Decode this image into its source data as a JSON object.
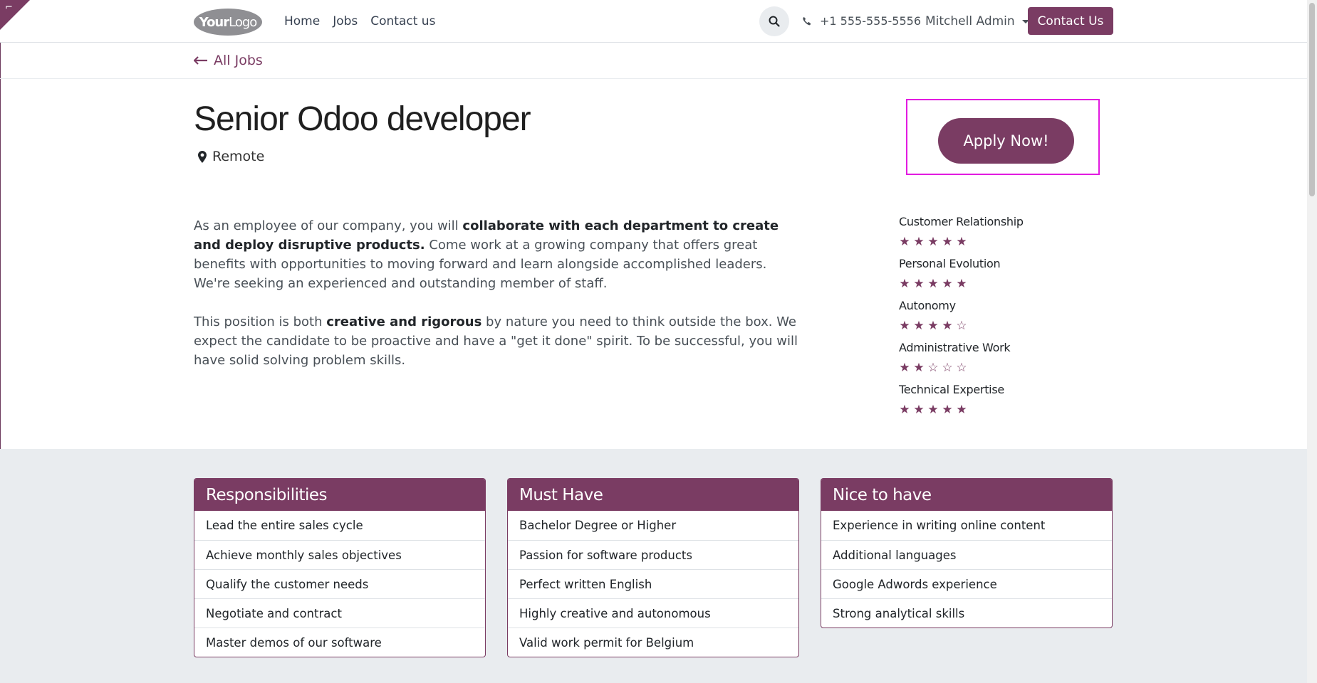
{
  "header": {
    "logo_main": "Your",
    "logo_thin": "Logo",
    "nav": [
      "Home",
      "Jobs",
      "Contact us"
    ],
    "phone": "+1 555-555-5556",
    "user": "Mitchell Admin",
    "contact_button": "Contact Us"
  },
  "back": {
    "label": "All Jobs"
  },
  "job": {
    "title": "Senior Odoo developer",
    "location": "Remote",
    "apply_label": "Apply Now!"
  },
  "description": {
    "p1_a": "As an employee of our company, you will ",
    "p1_b": "collaborate with each department to create and deploy disruptive products.",
    "p1_c": " Come work at a growing company that offers great benefits with opportunities to moving forward and learn alongside accomplished leaders. We're seeking an experienced and outstanding member of staff.",
    "p2_a": "This position is both ",
    "p2_b": "creative and rigorous",
    "p2_c": " by nature you need to think outside the box. We expect the candidate to be proactive and have a \"get it done\" spirit. To be successful, you will have solid solving problem skills."
  },
  "ratings": [
    {
      "label": "Customer Relationship",
      "value": 5
    },
    {
      "label": "Personal Evolution",
      "value": 5
    },
    {
      "label": "Autonomy",
      "value": 4
    },
    {
      "label": "Administrative Work",
      "value": 2
    },
    {
      "label": "Technical Expertise",
      "value": 5
    }
  ],
  "cards": [
    {
      "title": "Responsibilities",
      "items": [
        "Lead the entire sales cycle",
        "Achieve monthly sales objectives",
        "Qualify the customer needs",
        "Negotiate and contract",
        "Master demos of our software"
      ]
    },
    {
      "title": "Must Have",
      "items": [
        "Bachelor Degree or Higher",
        "Passion for software products",
        "Perfect written English",
        "Highly creative and autonomous",
        "Valid work permit for Belgium"
      ]
    },
    {
      "title": "Nice to have",
      "items": [
        "Experience in writing online content",
        "Additional languages",
        "Google Adwords experience",
        "Strong analytical skills"
      ]
    }
  ],
  "colors": {
    "brand": "#7a3c63",
    "highlight": "#e21be0",
    "section_bg": "#e9ecef"
  }
}
